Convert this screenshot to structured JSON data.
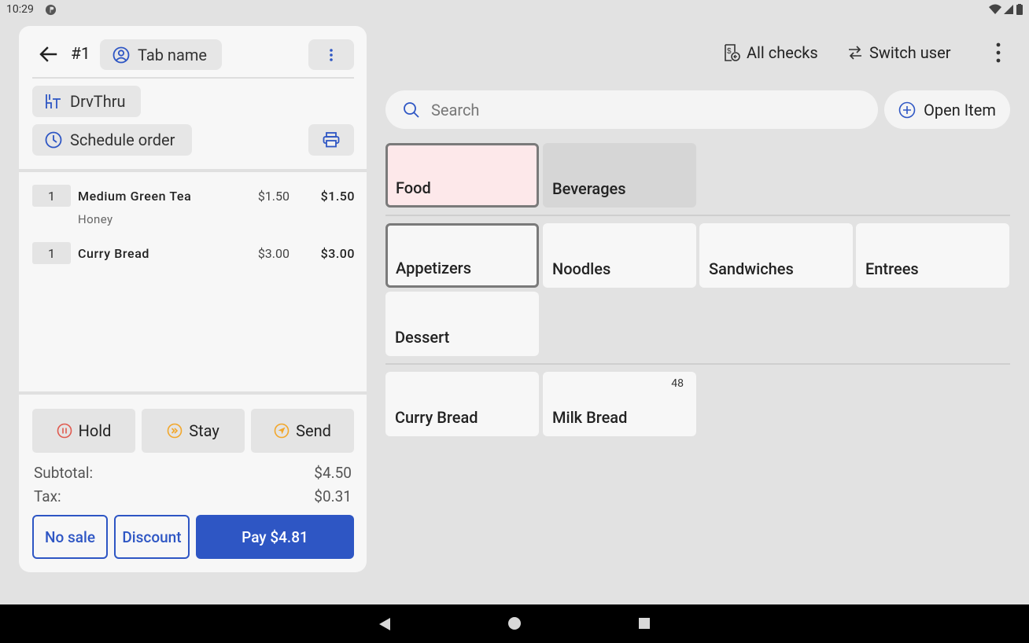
{
  "status_bar": {
    "time": "10:29"
  },
  "order": {
    "number": "#1",
    "tab_name_label": "Tab name",
    "dining_option": "DrvThru",
    "schedule_label": "Schedule order",
    "items": [
      {
        "qty": "1",
        "name": "Medium Green Tea",
        "unit_price": "$1.50",
        "total": "$1.50",
        "modifier": "Honey"
      },
      {
        "qty": "1",
        "name": "Curry Bread",
        "unit_price": "$3.00",
        "total": "$3.00",
        "modifier": ""
      }
    ],
    "actions": {
      "hold": "Hold",
      "stay": "Stay",
      "send": "Send"
    },
    "subtotal_label": "Subtotal:",
    "subtotal_value": "$4.50",
    "tax_label": "Tax:",
    "tax_value": "$0.31",
    "no_sale_label": "No sale",
    "discount_label": "Discount",
    "pay_label": "Pay $4.81"
  },
  "toolbar": {
    "all_checks": "All checks",
    "switch_user": "Switch user"
  },
  "search": {
    "placeholder": "Search"
  },
  "open_item_label": "Open Item",
  "menu_groups": [
    {
      "label": "Food",
      "selected": true
    },
    {
      "label": "Beverages",
      "selected": false
    }
  ],
  "categories": [
    {
      "label": "Appetizers",
      "selected": true
    },
    {
      "label": "Noodles"
    },
    {
      "label": "Sandwiches"
    },
    {
      "label": "Entrees"
    },
    {
      "label": "Dessert"
    }
  ],
  "products": [
    {
      "label": "Curry Bread",
      "badge": ""
    },
    {
      "label": "Milk Bread",
      "badge": "48"
    }
  ],
  "colors": {
    "accent": "#2e56c4",
    "hold_icon": "#e05a4f",
    "stay_icon": "#f2a72b",
    "send_icon": "#f2a72b",
    "food_tile": "#fde8ea",
    "beverages_tile": "#d6d6d6"
  },
  "icons": {
    "back": "arrow-left-icon",
    "tab": "person-circle-icon",
    "menu": "vertical-dots-icon",
    "dining": "dining-table-icon",
    "schedule": "clock-icon",
    "print": "printer-icon",
    "hold": "pause-circle-icon",
    "stay": "fast-forward-circle-icon",
    "send": "send-circle-icon",
    "all_checks": "receipt-icon",
    "switch_user": "swap-arrows-icon",
    "overflow": "vertical-dots-icon",
    "search": "search-icon",
    "open_item": "plus-circle-icon"
  }
}
